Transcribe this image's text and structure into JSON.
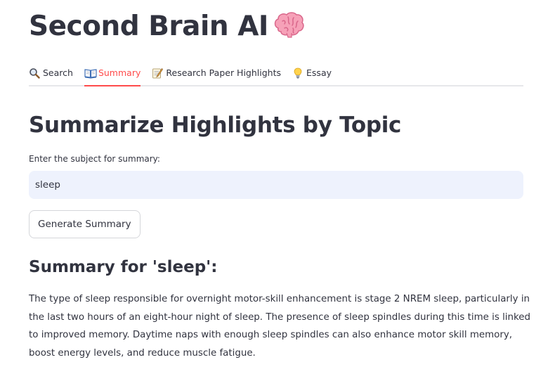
{
  "app": {
    "title": "Second Brain AI",
    "title_icon": "brain-icon"
  },
  "tabs": [
    {
      "label": "Search",
      "icon": "magnifier-icon",
      "active": false
    },
    {
      "label": "Summary",
      "icon": "open-book-icon",
      "active": true
    },
    {
      "label": "Research Paper Highlights",
      "icon": "memo-icon",
      "active": false
    },
    {
      "label": "Essay",
      "icon": "light-bulb-icon",
      "active": false
    }
  ],
  "main": {
    "heading": "Summarize Highlights by Topic",
    "input_label": "Enter the subject for summary:",
    "input_value": "sleep",
    "button_label": "Generate Summary",
    "result_heading": "Summary for 'sleep':",
    "result_text": "The type of sleep responsible for overnight motor-skill enhancement is stage 2 NREM sleep, particularly in the last two hours of an eight-hour night of sleep. The presence of sleep spindles during this time is linked to improved memory. Daytime naps with enough sleep spindles can also enhance motor skill memory, boost energy levels, and reduce muscle fatigue."
  },
  "colors": {
    "accent": "#ff4b4b",
    "text": "#31333f",
    "input_bg": "#eef2fd",
    "tab_border": "#e6e7ea"
  }
}
